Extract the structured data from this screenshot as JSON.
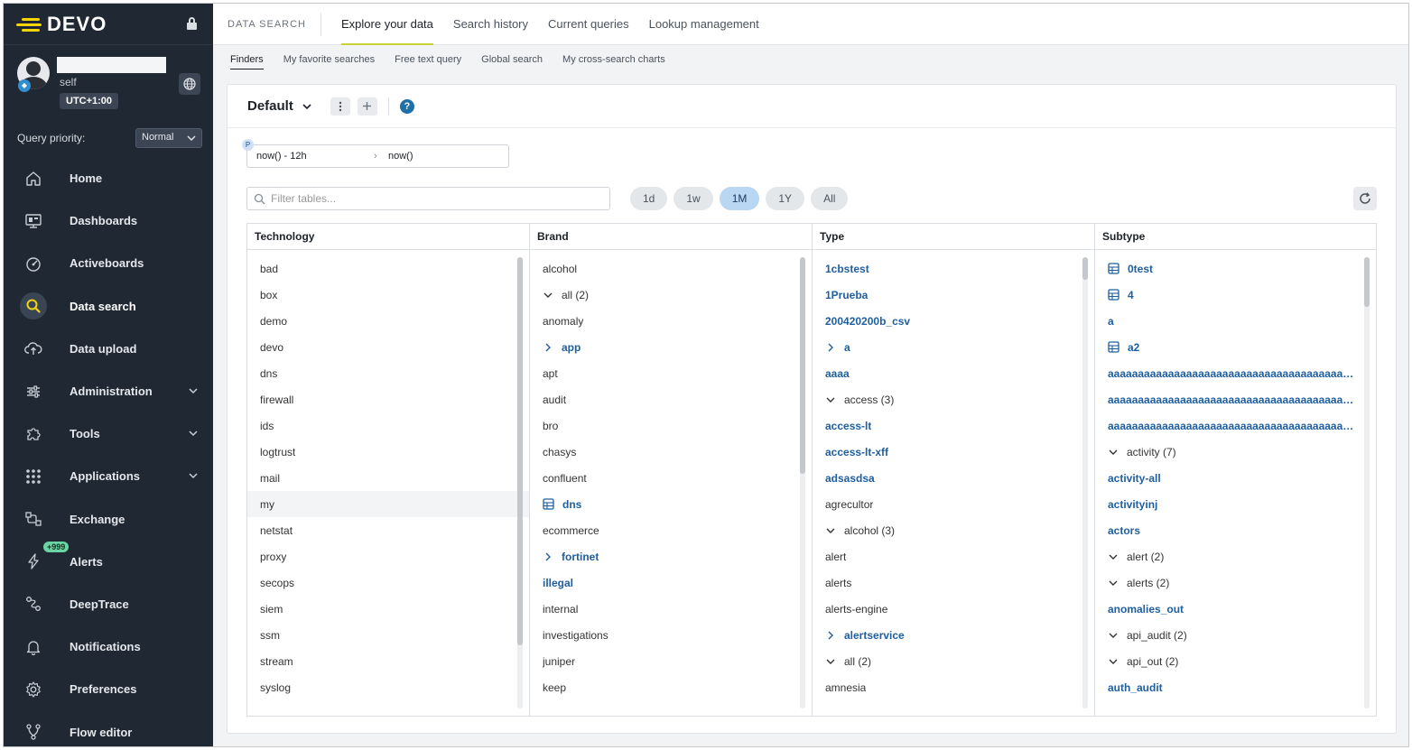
{
  "app": {
    "name": "DEVO"
  },
  "user": {
    "name_redacted": "",
    "role": "self",
    "timezone": "UTC+1:00"
  },
  "query_priority": {
    "label": "Query priority:",
    "value": "Normal"
  },
  "nav": [
    {
      "id": "home",
      "label": "Home",
      "icon": "home-icon"
    },
    {
      "id": "dashboards",
      "label": "Dashboards",
      "icon": "dashboard-icon"
    },
    {
      "id": "activeboards",
      "label": "Activeboards",
      "icon": "gauge-icon"
    },
    {
      "id": "data-search",
      "label": "Data search",
      "icon": "search-icon",
      "active": true
    },
    {
      "id": "data-upload",
      "label": "Data upload",
      "icon": "cloud-upload-icon"
    },
    {
      "id": "administration",
      "label": "Administration",
      "icon": "sliders-icon",
      "expandable": true
    },
    {
      "id": "tools",
      "label": "Tools",
      "icon": "puzzle-icon",
      "expandable": true
    },
    {
      "id": "applications",
      "label": "Applications",
      "icon": "grid-icon",
      "expandable": true
    },
    {
      "id": "exchange",
      "label": "Exchange",
      "icon": "exchange-icon"
    },
    {
      "id": "alerts",
      "label": "Alerts",
      "icon": "bolt-icon",
      "badge": "+999"
    },
    {
      "id": "deeptrace",
      "label": "DeepTrace",
      "icon": "trace-icon"
    },
    {
      "id": "notifications",
      "label": "Notifications",
      "icon": "bell-icon"
    },
    {
      "id": "preferences",
      "label": "Preferences",
      "icon": "gear-icon"
    },
    {
      "id": "flow-editor",
      "label": "Flow editor",
      "icon": "flow-icon"
    }
  ],
  "topbar": {
    "section": "DATA SEARCH",
    "tabs": [
      "Explore your data",
      "Search history",
      "Current queries",
      "Lookup management"
    ],
    "active_tab": 0
  },
  "subtabs": {
    "items": [
      "Finders",
      "My favorite searches",
      "Free text query",
      "Global search",
      "My cross-search charts"
    ],
    "active": 0
  },
  "finder": {
    "title": "Default",
    "range": {
      "marker": "P",
      "from": "now() - 12h",
      "to": "now()"
    },
    "filter_placeholder": "Filter tables...",
    "periods": [
      "1d",
      "1w",
      "1M",
      "1Y",
      "All"
    ],
    "active_period": "1M"
  },
  "columns": [
    {
      "header": "Technology",
      "rows": [
        {
          "text": "bad"
        },
        {
          "text": "box"
        },
        {
          "text": "demo"
        },
        {
          "text": "devo"
        },
        {
          "text": "dns"
        },
        {
          "text": "firewall"
        },
        {
          "text": "ids"
        },
        {
          "text": "logtrust"
        },
        {
          "text": "mail"
        },
        {
          "text": "my",
          "highlight": true
        },
        {
          "text": "netstat"
        },
        {
          "text": "proxy"
        },
        {
          "text": "secops"
        },
        {
          "text": "siem"
        },
        {
          "text": "ssm"
        },
        {
          "text": "stream"
        },
        {
          "text": "syslog"
        }
      ]
    },
    {
      "header": "Brand",
      "rows": [
        {
          "text": "alcohol"
        },
        {
          "text": "all (2)",
          "chevron": "down"
        },
        {
          "text": "anomaly"
        },
        {
          "text": "app",
          "chevron": "right",
          "link": true
        },
        {
          "text": "apt"
        },
        {
          "text": "audit"
        },
        {
          "text": "bro"
        },
        {
          "text": "chasys"
        },
        {
          "text": "confluent"
        },
        {
          "text": "dns",
          "table": true,
          "link": true
        },
        {
          "text": "ecommerce"
        },
        {
          "text": "fortinet",
          "chevron": "right",
          "link": true
        },
        {
          "text": "illegal",
          "link": true
        },
        {
          "text": "internal"
        },
        {
          "text": "investigations"
        },
        {
          "text": "juniper"
        },
        {
          "text": "keep"
        }
      ]
    },
    {
      "header": "Type",
      "rows": [
        {
          "text": "1cbstest",
          "link": true
        },
        {
          "text": "1Prueba",
          "link": true
        },
        {
          "text": "200420200b_csv",
          "link": true
        },
        {
          "text": "a",
          "chevron": "right",
          "link": true
        },
        {
          "text": "aaaa",
          "link": true
        },
        {
          "text": "access (3)",
          "chevron": "down"
        },
        {
          "text": "access-lt",
          "link": true
        },
        {
          "text": "access-lt-xff",
          "link": true
        },
        {
          "text": "adsasdsa",
          "link": true
        },
        {
          "text": "agrecultor"
        },
        {
          "text": "alcohol (3)",
          "chevron": "down"
        },
        {
          "text": "alert"
        },
        {
          "text": "alerts"
        },
        {
          "text": "alerts-engine"
        },
        {
          "text": "alertservice",
          "chevron": "right",
          "link": true
        },
        {
          "text": "all (2)",
          "chevron": "down"
        },
        {
          "text": "amnesia"
        }
      ]
    },
    {
      "header": "Subtype",
      "rows": [
        {
          "text": "0test",
          "table": true,
          "link": true
        },
        {
          "text": "4",
          "table": true,
          "link": true
        },
        {
          "text": "a",
          "link": true
        },
        {
          "text": "a2",
          "table": true,
          "link": true
        },
        {
          "text": "aaaaaaaaaaaaaaaaaaaaaaaaaaaaaaaaaaaaaaaaaab...",
          "link": true
        },
        {
          "text": "aaaaaaaaaaaaaaaaaaaaaaaaaaaaaaaaaaaaaaaaaab...",
          "link": true
        },
        {
          "text": "aaaaaaaaaaaaaaaaaaaaaaaaaaaaaaaaaaaaaaaaaab...",
          "link": true
        },
        {
          "text": "activity (7)",
          "chevron": "down"
        },
        {
          "text": "activity-all",
          "link": true
        },
        {
          "text": "activityinj",
          "link": true
        },
        {
          "text": "actors",
          "link": true
        },
        {
          "text": "alert (2)",
          "chevron": "down"
        },
        {
          "text": "alerts (2)",
          "chevron": "down"
        },
        {
          "text": "anomalies_out",
          "link": true
        },
        {
          "text": "api_audit (2)",
          "chevron": "down"
        },
        {
          "text": "api_out (2)",
          "chevron": "down"
        },
        {
          "text": "auth_audit",
          "link": true
        }
      ]
    }
  ],
  "scroll": [
    {
      "fraction_top": 0.0,
      "fraction_size": 0.86
    },
    {
      "fraction_top": 0.0,
      "fraction_size": 0.48
    },
    {
      "fraction_top": 0.0,
      "fraction_size": 0.05
    },
    {
      "fraction_top": 0.0,
      "fraction_size": 0.11
    }
  ],
  "colors": {
    "sidebar": "#1f2833",
    "accent": "#c7d234",
    "link": "#1f5fa0",
    "active_pill": "#b9d6f2"
  }
}
